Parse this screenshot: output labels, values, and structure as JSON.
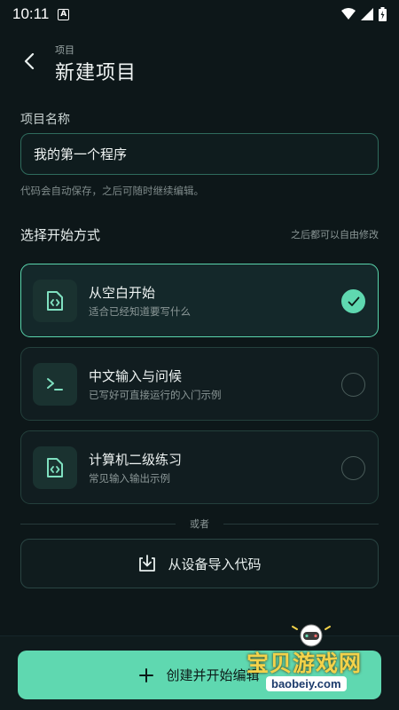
{
  "status_bar": {
    "time": "10:11",
    "notification_letter": "A"
  },
  "header": {
    "eyebrow": "项目",
    "title": "新建项目"
  },
  "project_name": {
    "label": "项目名称",
    "value": "我的第一个程序",
    "hint": "代码会自动保存，之后可随时继续编辑。"
  },
  "start_mode": {
    "title": "选择开始方式",
    "aside": "之后都可以自由修改",
    "options": [
      {
        "title": "从空白开始",
        "subtitle": "适合已经知道要写什么",
        "icon": "code-file-icon",
        "selected": true
      },
      {
        "title": "中文输入与问候",
        "subtitle": "已写好可直接运行的入门示例",
        "icon": "terminal-icon",
        "selected": false
      },
      {
        "title": "计算机二级练习",
        "subtitle": "常见输入输出示例",
        "icon": "code-file-icon",
        "selected": false
      }
    ]
  },
  "divider": {
    "text": "或者"
  },
  "import": {
    "label": "从设备导入代码",
    "icon": "download-icon"
  },
  "create": {
    "label": "创建并开始编辑",
    "icon": "plus-icon"
  },
  "watermark": {
    "text": "宝贝游戏网",
    "url": "baobeiy.com"
  },
  "colors": {
    "accent": "#5fd8b0",
    "background": "#0d1719",
    "card_border": "#24403c"
  }
}
